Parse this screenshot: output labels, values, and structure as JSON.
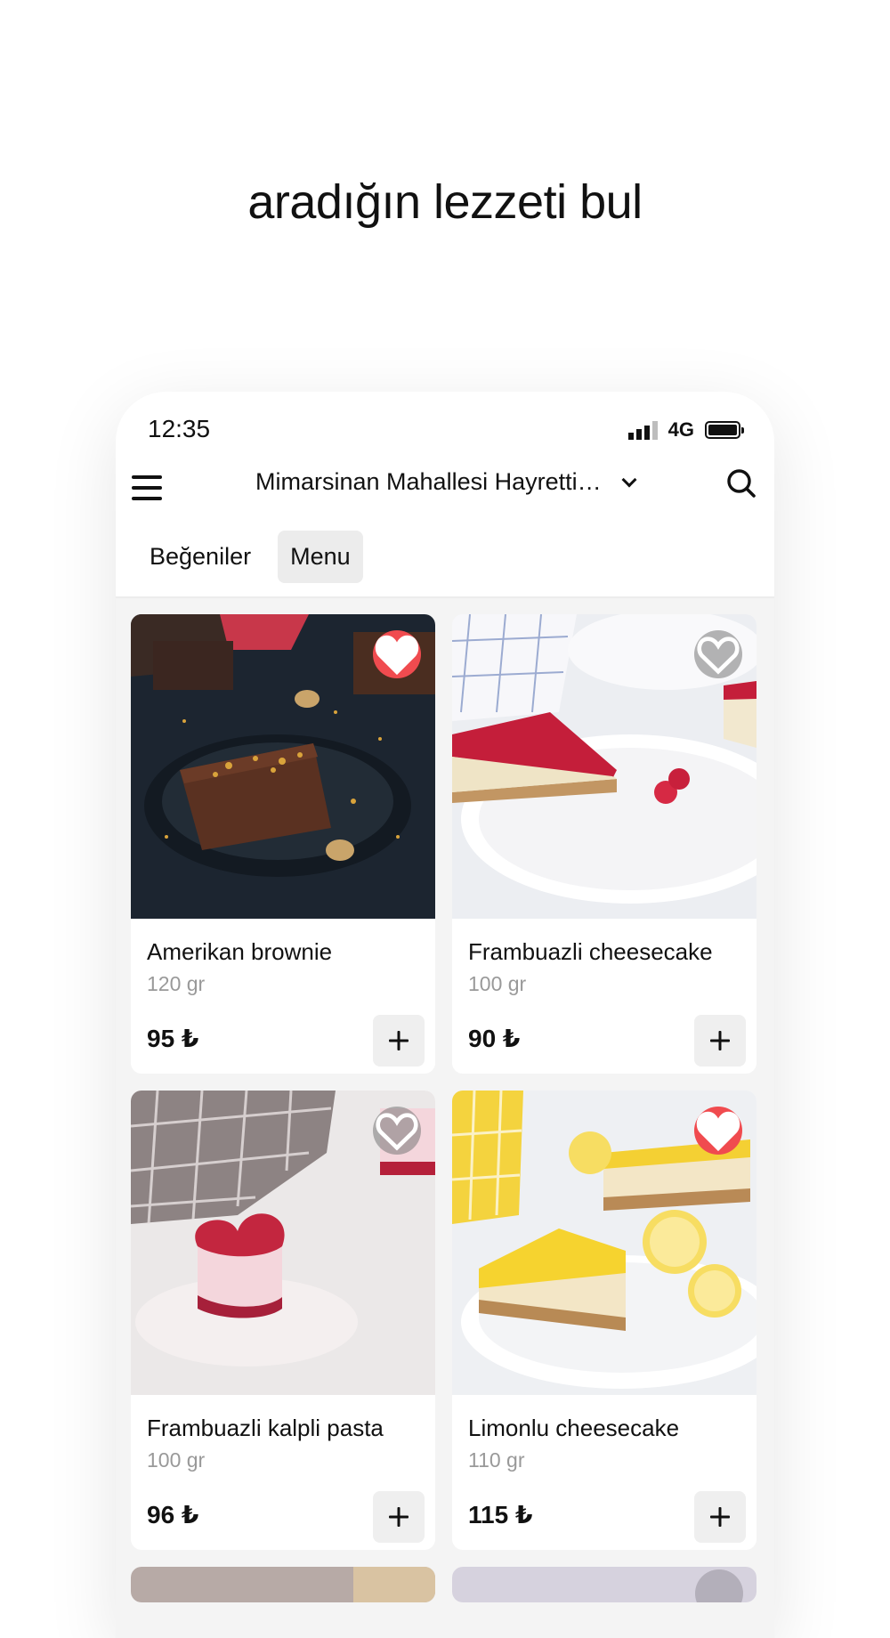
{
  "headline": "aradığın lezzeti bul",
  "status": {
    "time": "12:35",
    "network": "4G"
  },
  "nav": {
    "location": "Mimarsinan Mahallesi Hayrettin ..."
  },
  "tabs": [
    {
      "label": "Beğeniler",
      "active": false
    },
    {
      "label": "Menu",
      "active": true
    }
  ],
  "products": [
    {
      "name": "Amerikan brownie",
      "weight": "120 gr",
      "price": "95 ₺",
      "favorite": true
    },
    {
      "name": "Frambuazli cheesecake",
      "weight": "100 gr",
      "price": "90 ₺",
      "favorite": false
    },
    {
      "name": "Frambuazli kalpli pasta",
      "weight": "100 gr",
      "price": "96 ₺",
      "favorite": false
    },
    {
      "name": "Limonlu cheesecake",
      "weight": "110 gr",
      "price": "115 ₺",
      "favorite": true
    }
  ],
  "colors": {
    "favorite_active": "#f04b4f",
    "background": "#f4f4f4",
    "tab_active": "#ececec"
  }
}
